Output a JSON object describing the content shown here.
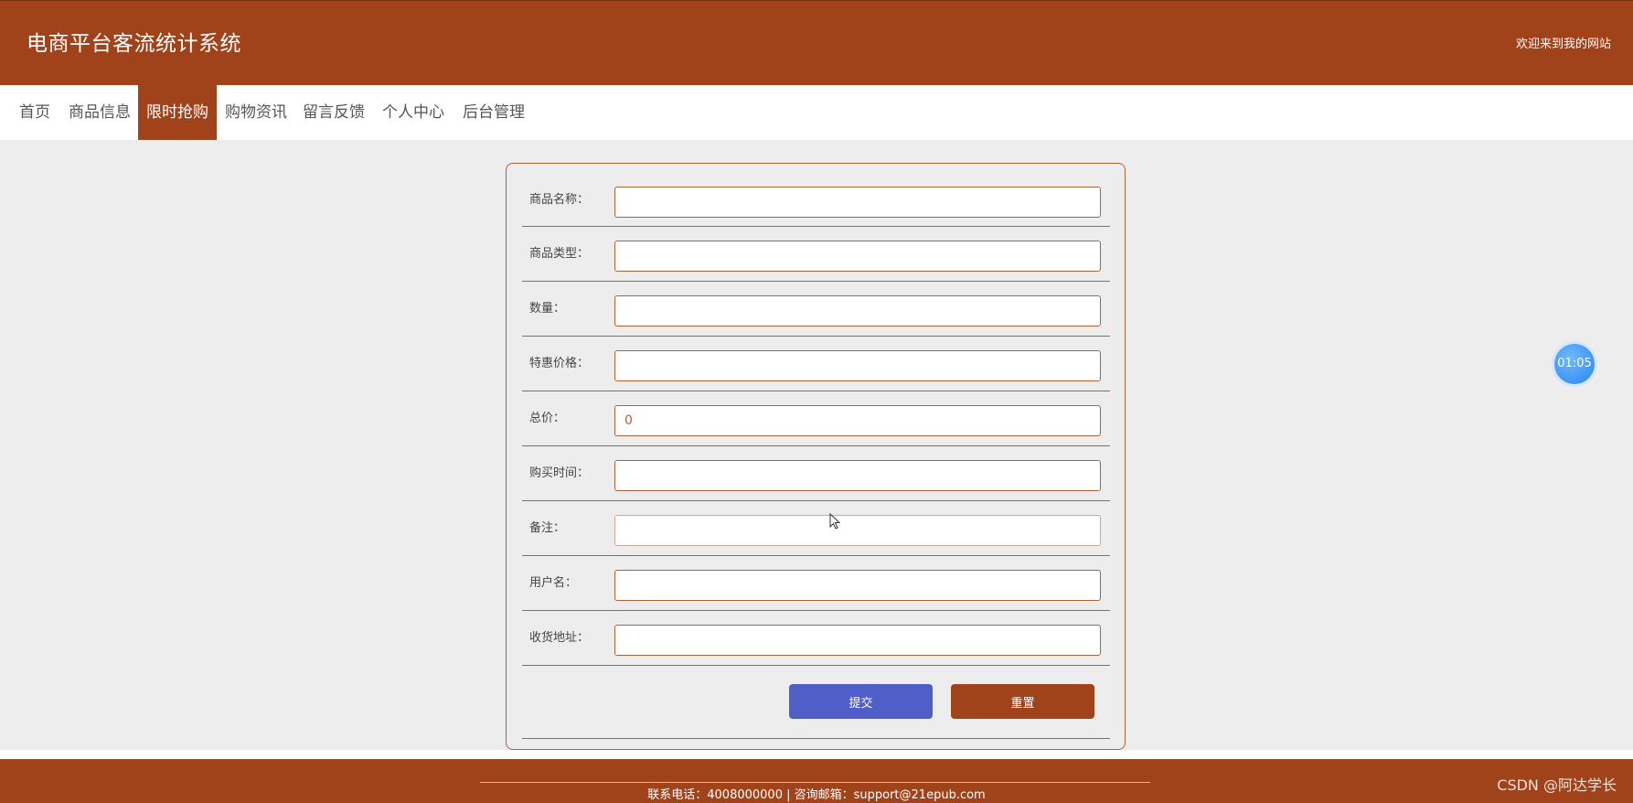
{
  "header": {
    "title": "电商平台客流统计系统",
    "welcome": "欢迎来到我的网站"
  },
  "nav": {
    "items": [
      {
        "label": "首页"
      },
      {
        "label": "商品信息"
      },
      {
        "label": "限时抢购"
      },
      {
        "label": "购物资讯"
      },
      {
        "label": "留言反馈"
      },
      {
        "label": "个人中心"
      },
      {
        "label": "后台管理"
      }
    ],
    "active": "限时抢购"
  },
  "form": {
    "fields": [
      {
        "label": "商品名称：",
        "value": ""
      },
      {
        "label": "商品类型：",
        "value": ""
      },
      {
        "label": "数量：",
        "value": ""
      },
      {
        "label": "特惠价格：",
        "value": ""
      },
      {
        "label": "总价：",
        "value": "0"
      },
      {
        "label": "购买时间：",
        "value": ""
      },
      {
        "label": "备注：",
        "value": ""
      },
      {
        "label": "用户名：",
        "value": ""
      },
      {
        "label": "收货地址：",
        "value": ""
      }
    ],
    "submit_label": "提交",
    "reset_label": "重置"
  },
  "timer": {
    "value": "01:05"
  },
  "footer": {
    "contact": "联系电话：4008000000 | 咨询邮箱：support@21epub.com"
  },
  "watermark": "CSDN @阿达学长",
  "colors": {
    "brand": "#a0421a",
    "submit": "#4f5fc7",
    "background": "#ededed",
    "timer": "#2a86f0"
  }
}
